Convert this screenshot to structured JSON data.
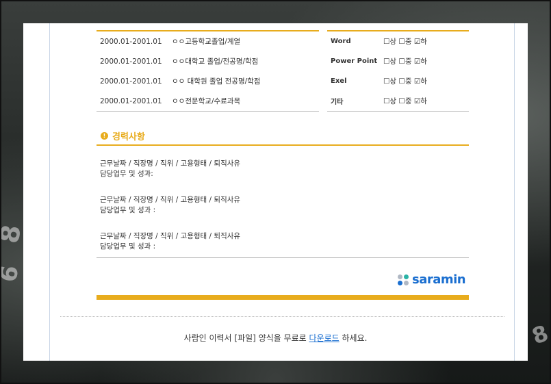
{
  "education": {
    "rows": [
      {
        "period": "2000.01-2001.01",
        "school": "ㅇㅇ고등학교졸업/계열"
      },
      {
        "period": "2000.01-2001.01",
        "school": "ㅇㅇ대학교 졸업/전공명/학점"
      },
      {
        "period": "2000.01-2001.01",
        "school": "ㅇㅇ 대학원 졸업 전공명/학점"
      },
      {
        "period": "2000.01-2001.01",
        "school": "ㅇㅇ전문학교/수료과목"
      }
    ]
  },
  "skills": {
    "rows": [
      {
        "name": "Word",
        "level": "☐상 ☐중 ☑하"
      },
      {
        "name": "Power Point",
        "level": "☐상 ☐중 ☑하"
      },
      {
        "name": "Exel",
        "level": "☐상 ☐중 ☑하"
      },
      {
        "name": "기타",
        "level": "☐상 ☐중 ☑하"
      }
    ]
  },
  "career": {
    "title": "경력사항",
    "icon": "exclamation-circle-icon",
    "entries": [
      {
        "line1": "근무날짜 / 직장명 / 직위 / 고용형태 / 퇴직사유",
        "line2": "담당업무 및 성과:"
      },
      {
        "line1": "근무날짜 / 직장명 / 직위 / 고용형태 / 퇴직사유",
        "line2": "담당업무 및 성과 :"
      },
      {
        "line1": "근무날짜  / 직장명 / 직위 / 고용형태 / 퇴직사유",
        "line2": "담당업무 및 성과 :"
      }
    ]
  },
  "brand": {
    "logo_text": "saramin",
    "colors": {
      "accent": "#e8ac1d",
      "logo_blue": "#1b6fd0",
      "dot_teal": "#2bb3a6",
      "dot_gray": "#b0b8c4"
    }
  },
  "footer": {
    "text_before": "사람인 이력서 [파일] 양식을 무료로 ",
    "link": "다운로드",
    "text_after": " 하세요."
  }
}
